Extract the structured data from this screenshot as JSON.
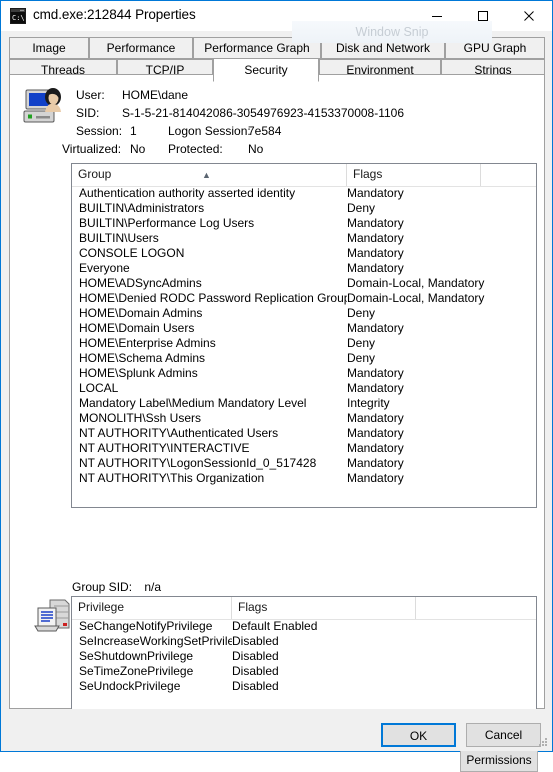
{
  "window": {
    "title": "cmd.exe:212844 Properties",
    "icon": "console-window-icon",
    "minimize_label": "Minimize",
    "maximize_label": "Maximize",
    "close_label": "Close",
    "border_color": "#0078d7"
  },
  "overlay": {
    "snip_watermark": "Window Snip"
  },
  "tabs": {
    "row1": [
      {
        "label": "Image",
        "active": false
      },
      {
        "label": "Performance",
        "active": false
      },
      {
        "label": "Performance Graph",
        "active": false
      },
      {
        "label": "Disk and Network",
        "active": false
      },
      {
        "label": "GPU Graph",
        "active": false
      }
    ],
    "row2": [
      {
        "label": "Threads",
        "active": false
      },
      {
        "label": "TCP/IP",
        "active": false
      },
      {
        "label": "Security",
        "active": true
      },
      {
        "label": "Environment",
        "active": false
      },
      {
        "label": "Strings",
        "active": false
      }
    ]
  },
  "user_info": {
    "user_label": "User:",
    "user_value": "HOME\\dane",
    "sid_label": "SID:",
    "sid_value": "S-1-5-21-814042086-3054976923-4153370008-1106",
    "session_label": "Session:",
    "session_value": "1",
    "logon_session_label": "Logon Session:",
    "logon_session_value": "7e584",
    "virtualized_label": "Virtualized:",
    "virtualized_value": "No",
    "protected_label": "Protected:",
    "protected_value": "No",
    "icon": "user-account-icon"
  },
  "groups_list": {
    "columns": [
      "Group",
      "Flags",
      ""
    ],
    "sort_column": "Group",
    "sort_direction": "ascending",
    "rows": [
      {
        "group": "Authentication authority asserted identity",
        "flags": "Mandatory"
      },
      {
        "group": "BUILTIN\\Administrators",
        "flags": "Deny"
      },
      {
        "group": "BUILTIN\\Performance Log Users",
        "flags": "Mandatory"
      },
      {
        "group": "BUILTIN\\Users",
        "flags": "Mandatory"
      },
      {
        "group": "CONSOLE LOGON",
        "flags": "Mandatory"
      },
      {
        "group": "Everyone",
        "flags": "Mandatory"
      },
      {
        "group": "HOME\\ADSyncAdmins",
        "flags": "Domain-Local, Mandatory"
      },
      {
        "group": "HOME\\Denied RODC Password Replication Group",
        "flags": "Domain-Local, Mandatory"
      },
      {
        "group": "HOME\\Domain Admins",
        "flags": "Deny"
      },
      {
        "group": "HOME\\Domain Users",
        "flags": "Mandatory"
      },
      {
        "group": "HOME\\Enterprise Admins",
        "flags": "Deny"
      },
      {
        "group": "HOME\\Schema Admins",
        "flags": "Deny"
      },
      {
        "group": "HOME\\Splunk Admins",
        "flags": "Mandatory"
      },
      {
        "group": "LOCAL",
        "flags": "Mandatory"
      },
      {
        "group": "Mandatory Label\\Medium Mandatory Level",
        "flags": "Integrity"
      },
      {
        "group": "MONOLITH\\Ssh Users",
        "flags": "Mandatory"
      },
      {
        "group": "NT AUTHORITY\\Authenticated Users",
        "flags": "Mandatory"
      },
      {
        "group": "NT AUTHORITY\\INTERACTIVE",
        "flags": "Mandatory"
      },
      {
        "group": "NT AUTHORITY\\LogonSessionId_0_517428",
        "flags": "Mandatory"
      },
      {
        "group": "NT AUTHORITY\\This Organization",
        "flags": "Mandatory"
      }
    ]
  },
  "group_sid": {
    "label": "Group SID:",
    "value": "n/a"
  },
  "privileges_list": {
    "icon": "privileges-icon",
    "columns": [
      "Privilege",
      "Flags",
      ""
    ],
    "rows": [
      {
        "privilege": "SeChangeNotifyPrivilege",
        "flags": "Default Enabled"
      },
      {
        "privilege": "SeIncreaseWorkingSetPrivilege",
        "flags": "Disabled"
      },
      {
        "privilege": "SeShutdownPrivilege",
        "flags": "Disabled"
      },
      {
        "privilege": "SeTimeZonePrivilege",
        "flags": "Disabled"
      },
      {
        "privilege": "SeUndockPrivilege",
        "flags": "Disabled"
      }
    ]
  },
  "buttons": {
    "permissions": "Permissions",
    "ok": "OK",
    "cancel": "Cancel"
  }
}
